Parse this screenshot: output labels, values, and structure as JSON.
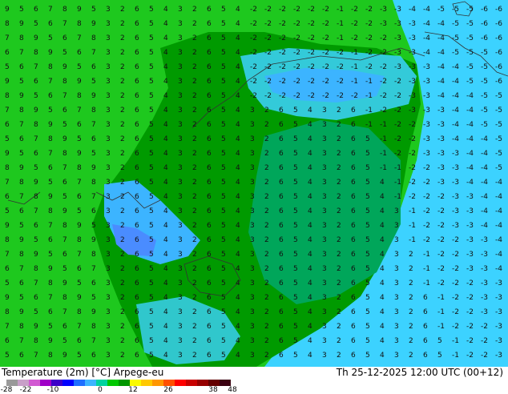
{
  "map": {
    "title": "Temperature (2m) [°C] Arpege-eu",
    "valid_time": "Th 25-12-2025 12:00 UTC (00+12)",
    "colorbar_ticks": [
      "-28",
      "-22",
      "-10",
      "0",
      "12",
      "26",
      "38",
      "48"
    ],
    "colorbar_colors": [
      "#9a9a9a",
      "#c8a0c8",
      "#d25ad2",
      "#a000c8",
      "#3c00c8",
      "#0000ff",
      "#1e6eff",
      "#3cb4ff",
      "#00d2a0",
      "#00c800",
      "#009600",
      "#fafa00",
      "#ffc800",
      "#ff9600",
      "#ff5000",
      "#ff0000",
      "#c80000",
      "#960000",
      "#640000",
      "#3a0010"
    ],
    "region_colors": {
      "sea_warm": "#1ec81e",
      "land_mild": "#009a00",
      "land_cool": "#00a65a",
      "snow_light": "#3cd2ff",
      "snow_dark": "#3cb4ff",
      "cold_blue": "#4a8cff",
      "deep_cold": "#1e78ff",
      "coast_line": "#333333"
    }
  }
}
